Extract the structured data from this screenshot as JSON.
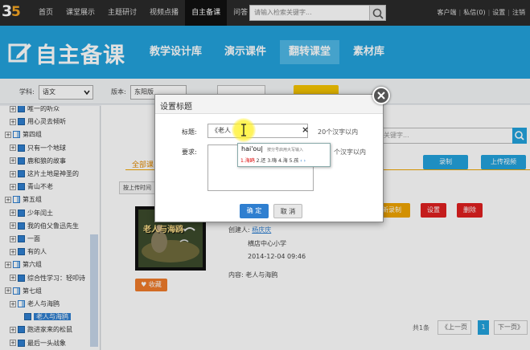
{
  "topnav": {
    "logo": {
      "digit": "3",
      "letter": "5"
    },
    "items": [
      "首页",
      "课堂展示",
      "主题研讨",
      "视频点播",
      "自主备课",
      "问答"
    ],
    "active_index": 4,
    "search_placeholder": "请输入检索关键字...",
    "right_links": [
      "客户端",
      "私信(0)",
      "设置",
      "注销"
    ]
  },
  "banner": {
    "title": "自主备课",
    "tabs": [
      "教学设计库",
      "演示课件",
      "翻转课堂",
      "素材库"
    ],
    "active_index": 2
  },
  "filters": {
    "subject_label": "学科:",
    "subject_value": "语文",
    "edition_label": "版本:",
    "edition_value": "东阳版"
  },
  "tree": [
    {
      "text": "唯一的听众",
      "type": "page",
      "indent": 1
    },
    {
      "text": "用心灵去倾听",
      "type": "page",
      "indent": 1
    },
    {
      "text": "第四组",
      "type": "group",
      "indent": 0
    },
    {
      "text": "只有一个地球",
      "type": "page",
      "indent": 1
    },
    {
      "text": "鹿和狼的故事",
      "type": "page",
      "indent": 1
    },
    {
      "text": "这片土地是神圣的",
      "type": "page",
      "indent": 1
    },
    {
      "text": "青山不老",
      "type": "page",
      "indent": 1
    },
    {
      "text": "第五组",
      "type": "group",
      "indent": 0
    },
    {
      "text": "少年闰土",
      "type": "page",
      "indent": 1
    },
    {
      "text": "我的伯父鲁迅先生",
      "type": "page",
      "indent": 1
    },
    {
      "text": "一面",
      "type": "page",
      "indent": 1
    },
    {
      "text": "有的人",
      "type": "page",
      "indent": 1
    },
    {
      "text": "第六组",
      "type": "group",
      "indent": 0
    },
    {
      "text": "综合性学习：轻叩诗",
      "type": "page",
      "indent": 1
    },
    {
      "text": "第七组",
      "type": "group",
      "indent": 0
    },
    {
      "text": "老人与海鸥",
      "type": "group",
      "indent": 1
    },
    {
      "text": "老人与海鸥",
      "type": "page",
      "indent": 2,
      "selected": true
    },
    {
      "text": "跑进家来的松鼠",
      "type": "page",
      "indent": 1
    },
    {
      "text": "最后一头战象",
      "type": "page",
      "indent": 1
    }
  ],
  "content": {
    "search_placeholder": "关键字...",
    "record_btn": "录制",
    "upload_btn": "上传视频",
    "tab_label": "全部课",
    "sort_label": "按上传时间",
    "actions": [
      {
        "label": "更新录制",
        "color": "#f0a400"
      },
      {
        "label": "设置",
        "color": "#e02020"
      },
      {
        "label": "删除",
        "color": "#e02020"
      }
    ],
    "thumb_caption": "老人与海鸥",
    "creator_label": "创建人:",
    "creator_name": "杨庆庆",
    "school": "横店中心小学",
    "date": "2014-12-04 09:46",
    "content_label": "内容:",
    "content_value": "老人与海鸥",
    "fav_label": "收藏",
    "total": "共1条",
    "prev": "《上一页",
    "page": "1",
    "next": "下一页》"
  },
  "dialog": {
    "title": "设置标题",
    "title_label": "标题:",
    "title_value": "《老人",
    "title_hint": "20个汉字以内",
    "req_label": "要求:",
    "req_hint": "个汉字以内",
    "ok": "确 定",
    "cancel": "取 消"
  },
  "ime": {
    "pinyin": "hai'ou|",
    "tip": "按分号启用大写输入",
    "candidates": [
      "1.海鸥",
      "2.还",
      "3.嗨",
      "4.海",
      "5.孩"
    ],
    "nav": "‹ ›"
  },
  "colors": {
    "brand_blue": "#23a2dc",
    "top_nav": "#2b2b2b",
    "accent_orange": "#f0a400",
    "danger_red": "#e02020"
  }
}
